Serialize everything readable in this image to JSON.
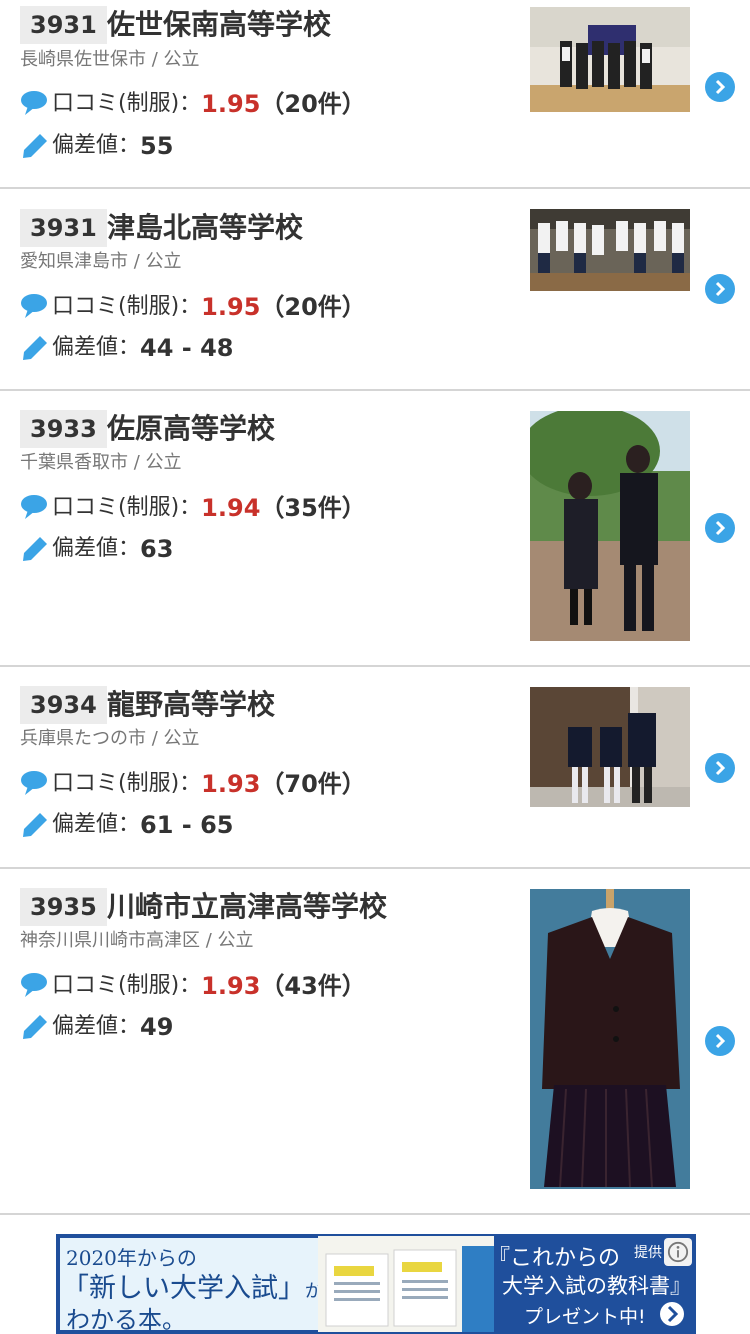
{
  "labels": {
    "kuchikomi": "口コミ(制服)：",
    "hensachi": "偏差値："
  },
  "schools": [
    {
      "rank": "3931",
      "name": "佐世保南高等学校",
      "location": "長崎県佐世保市 / 公立",
      "score": "1.95",
      "count": "（20件）",
      "hensachi": "55",
      "image": "group-photo"
    },
    {
      "rank": "3931",
      "name": "津島北高等学校",
      "location": "愛知県津島市 / 公立",
      "score": "1.95",
      "count": "（20件）",
      "hensachi": "44 - 48",
      "image": "classroom-photo"
    },
    {
      "rank": "3933",
      "name": "佐原高等学校",
      "location": "千葉県香取市 / 公立",
      "score": "1.94",
      "count": "（35件）",
      "hensachi": "63",
      "image": "two-students-photo"
    },
    {
      "rank": "3934",
      "name": "龍野高等学校",
      "location": "兵庫県たつの市 / 公立",
      "score": "1.93",
      "count": "（70件）",
      "hensachi": "61 - 65",
      "image": "students-entrance-photo"
    },
    {
      "rank": "3935",
      "name": "川崎市立高津高等学校",
      "location": "神奈川県川崎市高津区 / 公立",
      "score": "1.93",
      "count": "（43件）",
      "hensachi": "49",
      "image": "uniform-mannequin-photo"
    }
  ],
  "ad": {
    "line1": "2020年からの",
    "line2": "「新しい大学入試」",
    "line2b": "が",
    "line3": "わかる本。",
    "right1": "『これからの",
    "teikyo": "提供：",
    "right2": "大学入試の教科書』",
    "right3": "プレゼント中!"
  },
  "colors": {
    "score": "#c8312a",
    "accent_blue": "#3ba4e6",
    "divider": "#d5d5d5",
    "rank_bg": "#ececec"
  }
}
